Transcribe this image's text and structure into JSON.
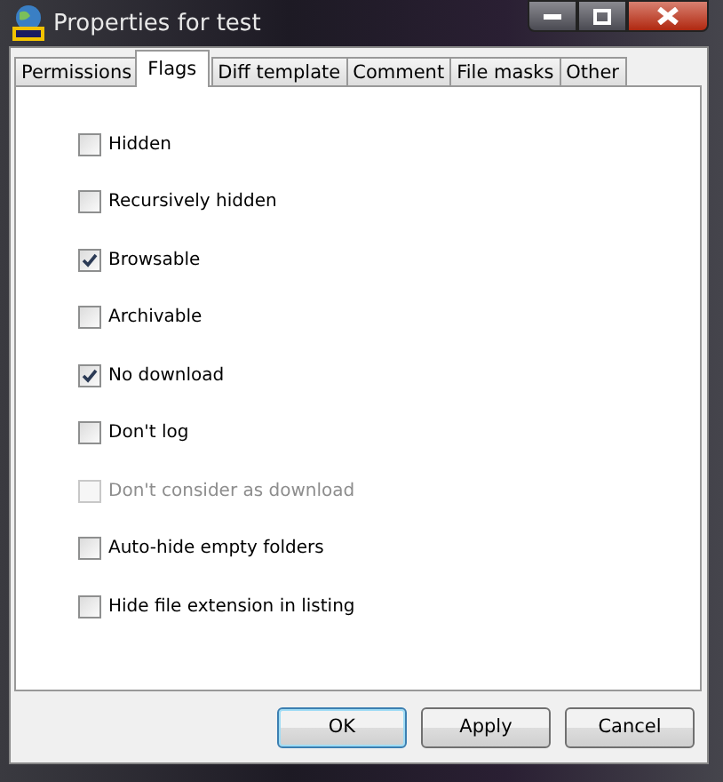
{
  "window": {
    "title": "Properties for test"
  },
  "tabs": [
    {
      "label": "Permissions",
      "selected": false
    },
    {
      "label": "Flags",
      "selected": true
    },
    {
      "label": "Diff template",
      "selected": false
    },
    {
      "label": "Comment",
      "selected": false
    },
    {
      "label": "File masks",
      "selected": false
    },
    {
      "label": "Other",
      "selected": false
    }
  ],
  "flags": [
    {
      "label": "Hidden",
      "checked": false,
      "disabled": false
    },
    {
      "label": "Recursively  hidden",
      "checked": false,
      "disabled": false
    },
    {
      "label": "Browsable",
      "checked": true,
      "disabled": false
    },
    {
      "label": "Archivable",
      "checked": false,
      "disabled": false
    },
    {
      "label": "No download",
      "checked": true,
      "disabled": false
    },
    {
      "label": "Don't log",
      "checked": false,
      "disabled": false
    },
    {
      "label": "Don't consider as download",
      "checked": false,
      "disabled": true
    },
    {
      "label": "Auto-hide empty folders",
      "checked": false,
      "disabled": false
    },
    {
      "label": "Hide file extension in listing",
      "checked": false,
      "disabled": false
    }
  ],
  "buttons": [
    {
      "label": "OK",
      "default": true
    },
    {
      "label": "Apply",
      "default": false
    },
    {
      "label": "Cancel",
      "default": false
    }
  ]
}
